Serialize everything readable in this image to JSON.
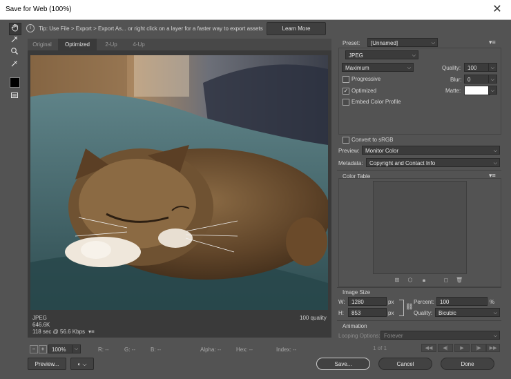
{
  "window": {
    "title": "Save for Web (100%)",
    "close": "✕"
  },
  "tip": {
    "icon": "i",
    "text": "Tip: Use File > Export > Export As...  or right click on a layer for a faster way to export assets",
    "learn_more": "Learn More"
  },
  "tabs": [
    {
      "label": "Original"
    },
    {
      "label": "Optimized"
    },
    {
      "label": "2-Up"
    },
    {
      "label": "4-Up"
    }
  ],
  "image_info": {
    "format": "JPEG",
    "size": "646.6K",
    "time": "118 sec @ 56.6 Kbps",
    "menu": "▾≡",
    "quality": "100 quality"
  },
  "status": {
    "zoom": "100%",
    "r": "R: --",
    "g": "G: --",
    "b": "B: --",
    "alpha": "Alpha: --",
    "hex": "Hex: --",
    "index": "Index: --"
  },
  "bottom": {
    "preview": "Preview...",
    "save": "Save...",
    "cancel": "Cancel",
    "done": "Done"
  },
  "settings": {
    "preset_label": "Preset:",
    "preset_value": "[Unnamed]",
    "format": "JPEG",
    "compression": "Maximum",
    "quality_label": "Quality:",
    "quality_value": "100",
    "blur_label": "Blur:",
    "blur_value": "0",
    "matte_label": "Matte:",
    "progressive": "Progressive",
    "optimized": "Optimized",
    "embed_profile": "Embed Color Profile",
    "convert_srgb": "Convert to sRGB",
    "preview_label": "Preview:",
    "preview_value": "Monitor Color",
    "metadata_label": "Metadata:",
    "metadata_value": "Copyright and Contact Info",
    "progressive_checked": false,
    "optimized_checked": true,
    "embed_checked": false,
    "convert_checked": false,
    "matte_color": "#ffffff"
  },
  "color_table": {
    "title": "Color Table"
  },
  "image_size": {
    "title": "Image Size",
    "w_label": "W:",
    "w_value": "1280",
    "h_label": "H:",
    "h_value": "853",
    "unit": "px",
    "percent_label": "Percent:",
    "percent_value": "100",
    "percent_unit": "%",
    "quality_label": "Quality:",
    "quality_value": "Bicubic"
  },
  "animation": {
    "title": "Animation",
    "looping_label": "Looping Options:",
    "looping_value": "Forever",
    "frame": "1 of 1"
  }
}
